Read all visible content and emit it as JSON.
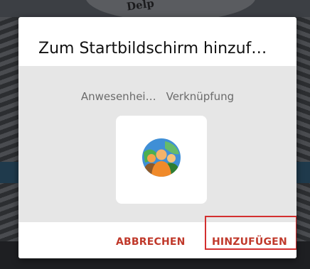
{
  "dialog": {
    "title": "Zum Startbildschirm hinzuf…",
    "shortcut_name": "Anwesenhei…",
    "shortcut_type": "Verknüpfung",
    "icon": "people-globe-icon",
    "cancel_label": "ABBRECHEN",
    "add_label": "HINZUFÜGEN"
  },
  "background": {
    "logo_text": "Delp"
  },
  "colors": {
    "accent": "#c0392b",
    "highlight": "#d32f2f",
    "preview_bg": "#e6e6e6"
  }
}
